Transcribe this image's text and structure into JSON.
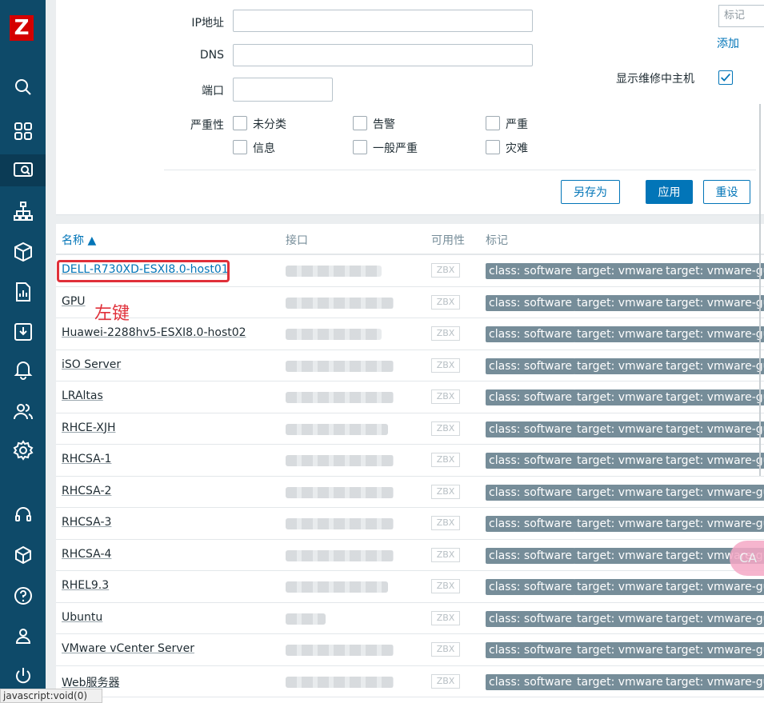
{
  "app": {
    "logo_letter": "Z"
  },
  "sidebar": {
    "icons": [
      "search-icon",
      "dashboard-icon",
      "monitoring-icon",
      "network-map-icon",
      "inventory-box-icon",
      "reports-icon",
      "data-collection-icon",
      "alerts-bell-icon",
      "users-icon",
      "settings-gear-icon",
      "support-headset-icon",
      "integrations-cube-icon",
      "help-icon",
      "user-profile-icon",
      "sign-out-power-icon"
    ]
  },
  "filter": {
    "ip_label": "IP地址",
    "ip_value": "",
    "dns_label": "DNS",
    "dns_value": "",
    "port_label": "端口",
    "port_value": "",
    "severity_label": "严重性",
    "severities": [
      {
        "label": "未分类",
        "checked": false
      },
      {
        "label": "告警",
        "checked": false
      },
      {
        "label": "严重",
        "checked": false
      },
      {
        "label": "信息",
        "checked": false
      },
      {
        "label": "一般严重",
        "checked": false
      },
      {
        "label": "灾难",
        "checked": false
      }
    ],
    "tag_placeholder": "标记",
    "add_link": "添加",
    "maintenance_label": "显示维修中主机",
    "maintenance_checked": true,
    "save_as_label": "另存为",
    "apply_label": "应用",
    "reset_label": "重设"
  },
  "table": {
    "headers": {
      "name": "名称 ▲",
      "interface": "接口",
      "availability": "可用性",
      "tags": "标记"
    },
    "rows": [
      {
        "name": "DELL-R730XD-ESXI8.0-host01",
        "zbx": "ZBX",
        "tags": [
          "class: software",
          "target: vmware",
          "target: vmware-gue"
        ]
      },
      {
        "name": "GPU",
        "zbx": "ZBX",
        "tags": [
          "class: software",
          "target: vmware",
          "target: vmware-gue"
        ]
      },
      {
        "name": "Huawei-2288hv5-ESXI8.0-host02",
        "zbx": "ZBX",
        "tags": [
          "class: software",
          "target: vmware",
          "target: vmware-gue"
        ]
      },
      {
        "name": "iSO Server",
        "zbx": "ZBX",
        "tags": [
          "class: software",
          "target: vmware",
          "target: vmware-gue"
        ]
      },
      {
        "name": "LRAltas",
        "zbx": "ZBX",
        "tags": [
          "class: software",
          "target: vmware",
          "target: vmware-gue"
        ]
      },
      {
        "name": "RHCE-XJH",
        "zbx": "ZBX",
        "tags": [
          "class: software",
          "target: vmware",
          "target: vmware-gue"
        ]
      },
      {
        "name": "RHCSA-1",
        "zbx": "ZBX",
        "tags": [
          "class: software",
          "target: vmware",
          "target: vmware-gue"
        ]
      },
      {
        "name": "RHCSA-2",
        "zbx": "ZBX",
        "tags": [
          "class: software",
          "target: vmware",
          "target: vmware-gue"
        ]
      },
      {
        "name": "RHCSA-3",
        "zbx": "ZBX",
        "tags": [
          "class: software",
          "target: vmware",
          "target: vmware-gue"
        ]
      },
      {
        "name": "RHCSA-4",
        "zbx": "ZBX",
        "tags": [
          "class: software",
          "target: vmware",
          "target: vmware-gue"
        ]
      },
      {
        "name": "RHEL9.3",
        "zbx": "ZBX",
        "tags": [
          "class: software",
          "target: vmware",
          "target: vmware-gue"
        ]
      },
      {
        "name": "Ubuntu",
        "zbx": "ZBX",
        "tags": [
          "class: software",
          "target: vmware",
          "target: vmware-gue"
        ]
      },
      {
        "name": "VMware vCenter Server",
        "zbx": "ZBX",
        "tags": [
          "class: software",
          "target: vmware",
          "target: vmware-gue"
        ]
      },
      {
        "name": "Web服务器",
        "zbx": "ZBX",
        "tags": [
          "class: software",
          "target: vmware",
          "target: vmware-gue"
        ]
      }
    ]
  },
  "annotation": {
    "text": "左键"
  },
  "float_bubble": {
    "text": "CA"
  },
  "statusbar": {
    "text": "javascript:void(0)"
  }
}
